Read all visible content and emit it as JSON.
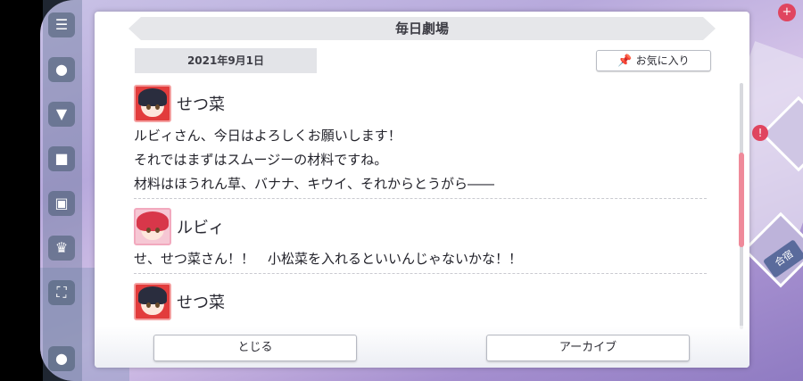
{
  "dialog": {
    "title": "毎日劇場",
    "date": "2021年9月1日",
    "favorite_label": "お気に入り",
    "favorite_icon": "pin-icon"
  },
  "entries": [
    {
      "speaker": "せつ菜",
      "lines": [
        "ルビィさん、今日はよろしくお願いします！",
        "それではまずはスムージーの材料ですね。",
        "材料はほうれん草、バナナ、キウイ、それからとうがら――"
      ]
    },
    {
      "speaker": "ルビィ",
      "lines": [
        "せ、せつ菜さん！！　小松菜を入れるといいんじゃないかな！！"
      ]
    },
    {
      "speaker": "せつ菜",
      "lines": []
    }
  ],
  "footer": {
    "close_label": "とじる",
    "archive_label": "アーカイブ"
  },
  "background": {
    "right_label": "合宿"
  },
  "colors": {
    "scroll_thumb": "#ef8a9a",
    "title_bar": "#e6e7ea"
  }
}
